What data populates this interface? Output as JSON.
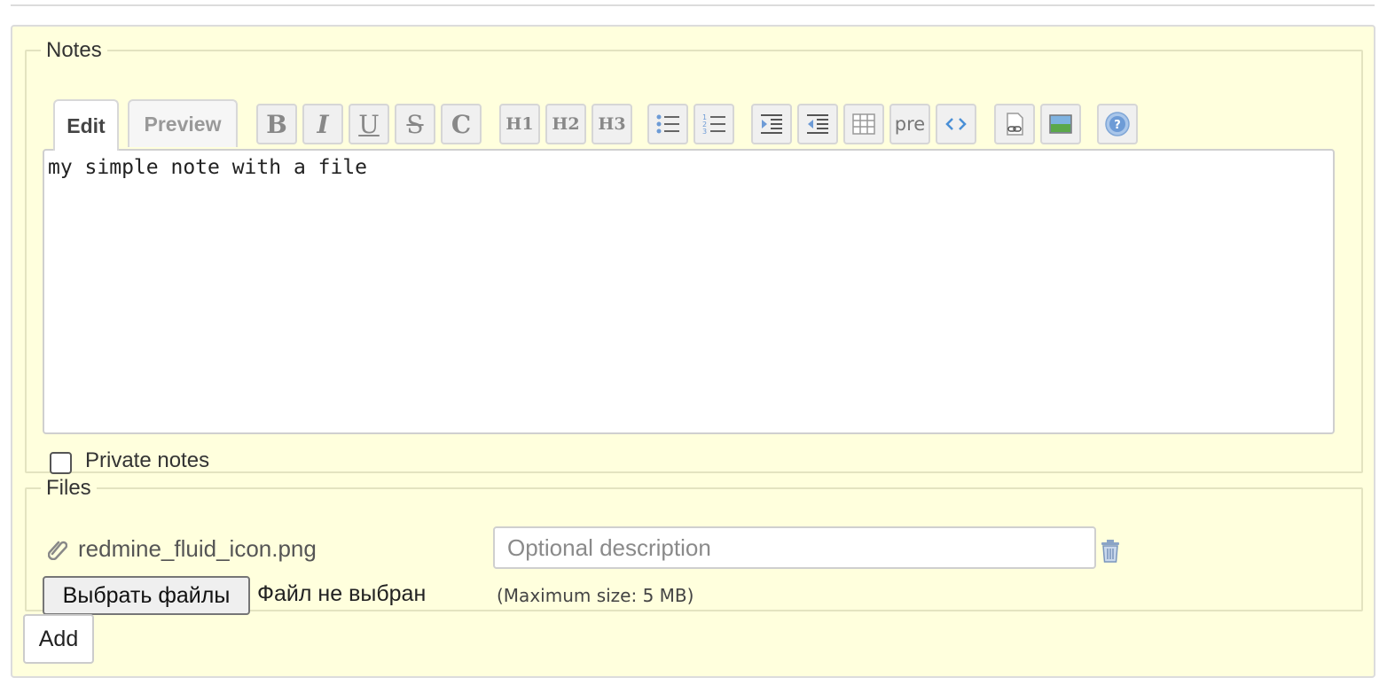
{
  "notes": {
    "legend": "Notes",
    "tabs": {
      "edit": "Edit",
      "preview": "Preview"
    },
    "toolbar": {
      "bold": "B",
      "italic": "I",
      "underline": "U",
      "strike": "S",
      "code": "C",
      "h1": "H1",
      "h2": "H2",
      "h3": "H3",
      "pre": "pre"
    },
    "text": "my simple note with a file",
    "private_label": "Private notes",
    "private_checked": false
  },
  "files": {
    "legend": "Files",
    "attached_file": "redmine_fluid_icon.png",
    "description_placeholder": "Optional description",
    "choose_button": "Выбрать файлы",
    "no_file": "Файл не выбран",
    "max_size": "(Maximum size: 5 MB)"
  },
  "add_button": "Add",
  "icons": [
    "unordered-list-icon",
    "ordered-list-icon",
    "indent-icon",
    "outdent-icon",
    "table-icon",
    "code-inline-icon",
    "link-icon",
    "image-icon",
    "help-icon",
    "paperclip-icon",
    "trash-icon"
  ]
}
